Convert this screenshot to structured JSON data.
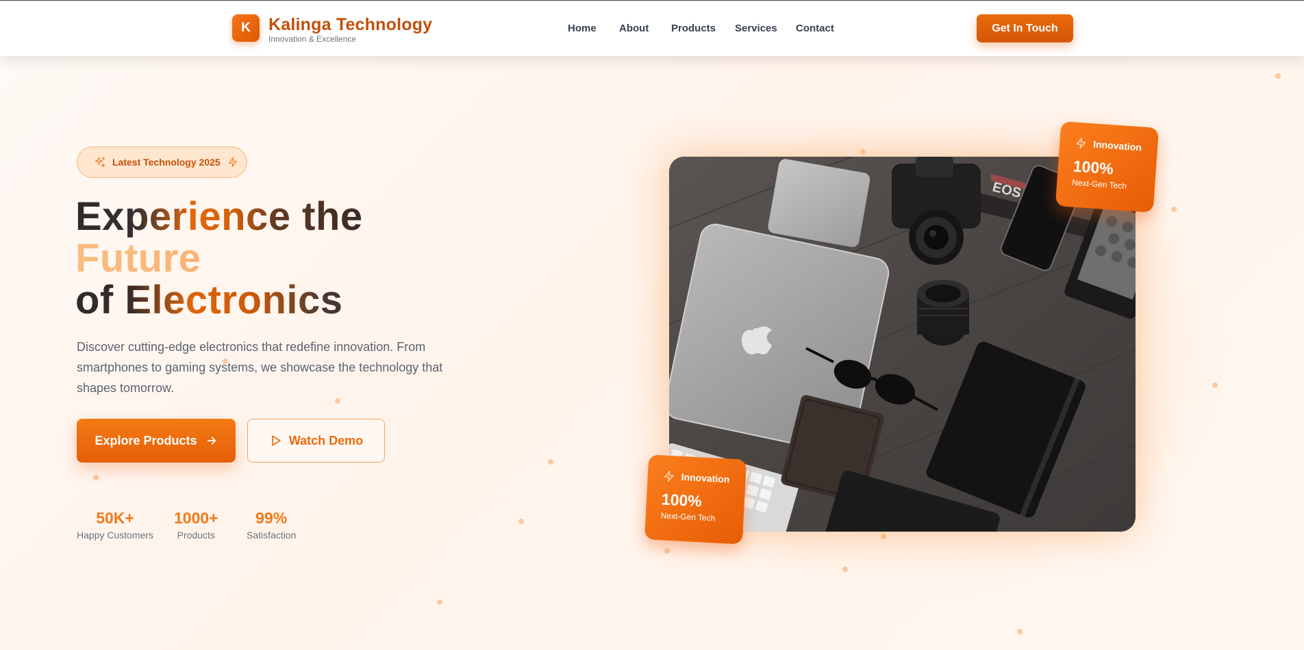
{
  "colors": {
    "accent": "#ea6a0c",
    "accent_light": "#fbbd80",
    "text_dark": "#2b2b2b",
    "muted": "#6b7280"
  },
  "brand": {
    "logo_letter": "K",
    "name": "Kalinga Technology",
    "tagline": "Innovation & Excellence"
  },
  "nav": {
    "items": [
      {
        "label": "Home"
      },
      {
        "label": "About"
      },
      {
        "label": "Products"
      },
      {
        "label": "Services"
      },
      {
        "label": "Contact"
      }
    ],
    "cta_label": "Get In Touch"
  },
  "hero": {
    "pill": {
      "label": "Latest Technology 2025",
      "left_icon": "sparkles-icon",
      "right_icon": "bolt-icon"
    },
    "headline": {
      "line1": "Experience the",
      "line2": "Future",
      "line3": "of Electronics"
    },
    "description": "Discover cutting-edge electronics that redefine innovation. From smartphones to gaming systems, we showcase the technology that shapes tomorrow.",
    "primary_button": {
      "label": "Explore Products",
      "icon": "arrow-right-icon"
    },
    "secondary_button": {
      "label": "Watch Demo",
      "icon": "play-icon"
    },
    "stats": [
      {
        "value": "50K+",
        "label": "Happy Customers"
      },
      {
        "value": "1000+",
        "label": "Products"
      },
      {
        "value": "99%",
        "label": "Satisfaction"
      }
    ]
  },
  "showcase": {
    "image_alt_icon": "electronics-flatlay-photo",
    "badges": [
      {
        "title": "Innovation",
        "value": "100%",
        "subtitle": "Next-Gen Tech",
        "icon": "bolt-icon"
      },
      {
        "title": "Innovation",
        "value": "100%",
        "subtitle": "Next-Gen Tech",
        "icon": "bolt-icon"
      }
    ]
  }
}
